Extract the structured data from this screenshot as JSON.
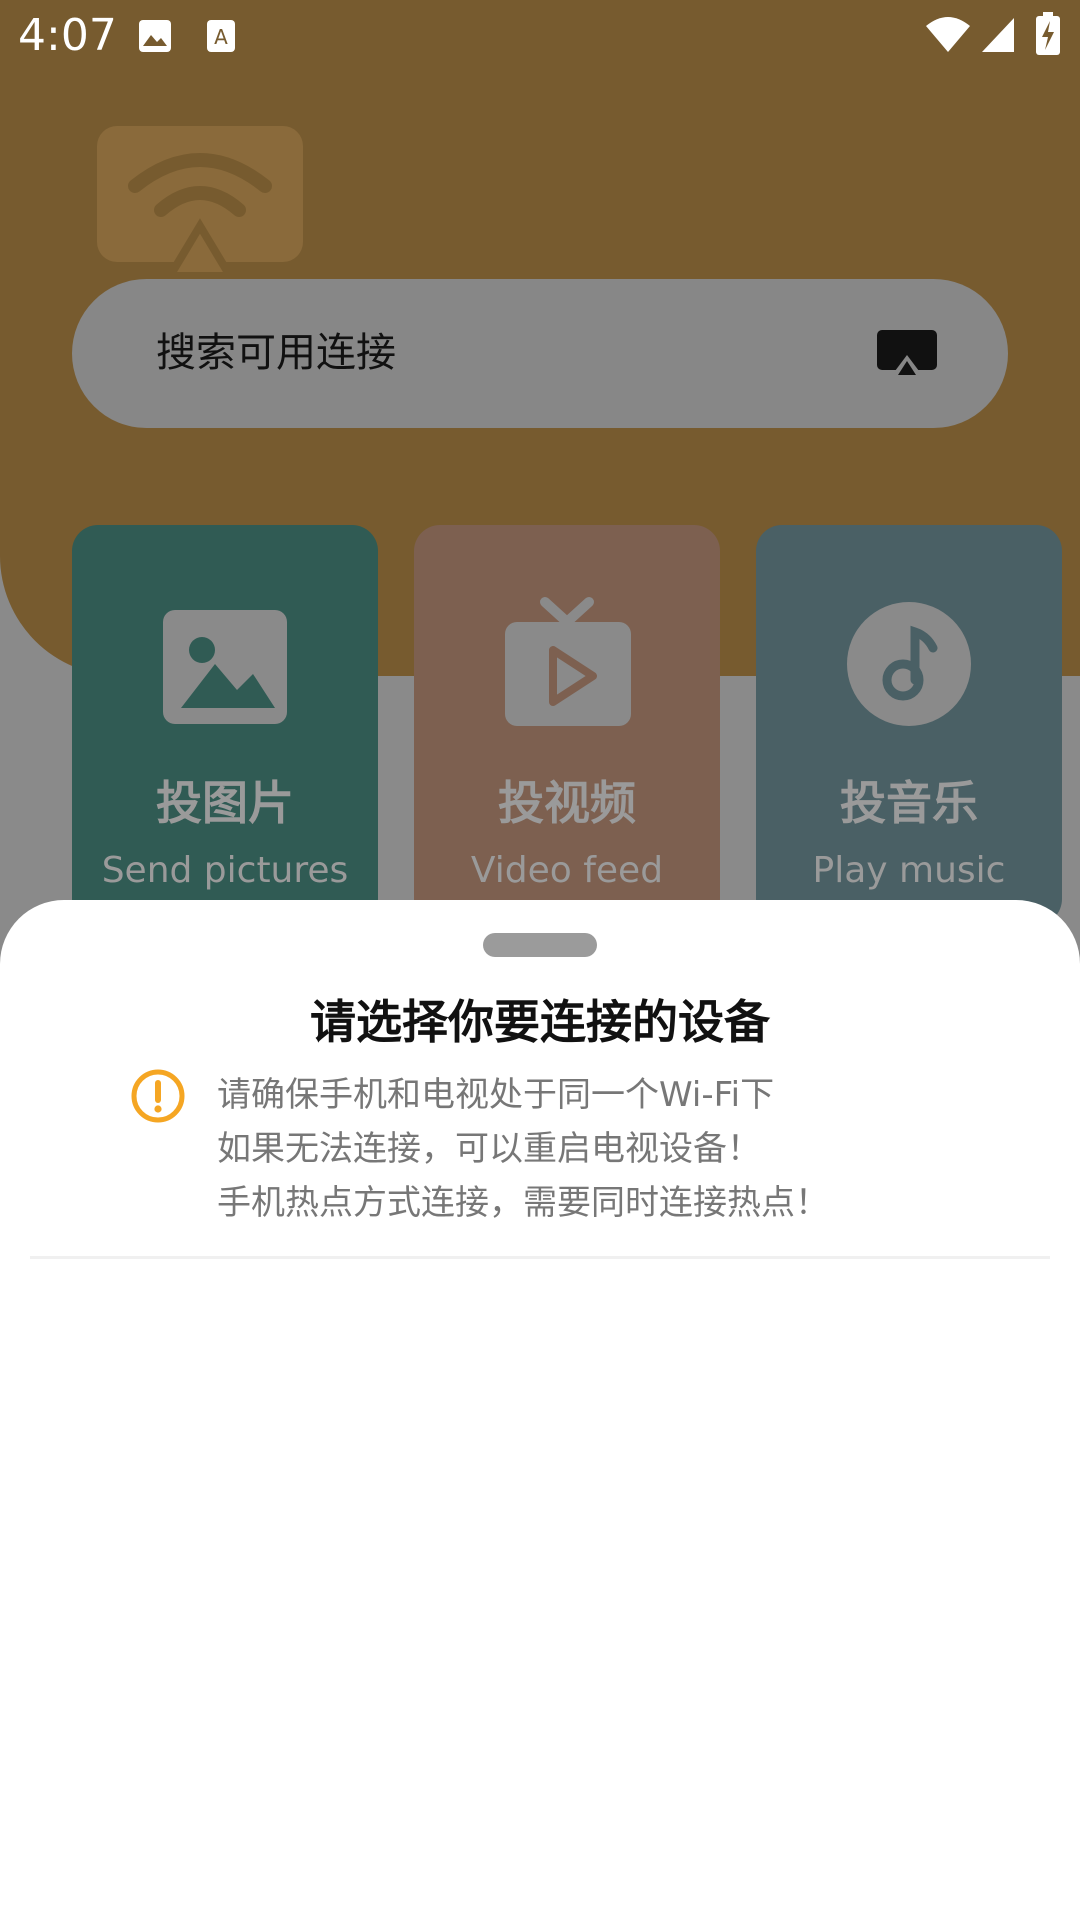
{
  "status_bar": {
    "time": "4:07",
    "left_icons": [
      "image-icon",
      "text-a-icon"
    ],
    "right_icons": [
      "wifi-icon",
      "signal-icon",
      "battery-charging-icon"
    ]
  },
  "header": {
    "color": "#775b2f",
    "hero_icon": "wifi-cast-icon"
  },
  "search": {
    "label": "搜索可用连接",
    "icon": "airplay-icon"
  },
  "cards": [
    {
      "title": "投图片",
      "subtitle": "Send pictures",
      "icon": "image-icon",
      "color": "#305b54"
    },
    {
      "title": "投视频",
      "subtitle": "Video feed",
      "icon": "tv-play-icon",
      "color": "#7d6050"
    },
    {
      "title": "投音乐",
      "subtitle": "Play music",
      "icon": "music-disc-icon",
      "color": "#4a6065"
    }
  ],
  "sheet": {
    "title": "请选择你要连接的设备",
    "warning_icon": "exclamation-circle-icon",
    "warning_color": "#f5a623",
    "lines": [
      "请确保手机和电视处于同一个Wi-Fi下",
      "如果无法连接，可以重启电视设备！",
      "手机热点方式连接，需要同时连接热点！"
    ]
  }
}
